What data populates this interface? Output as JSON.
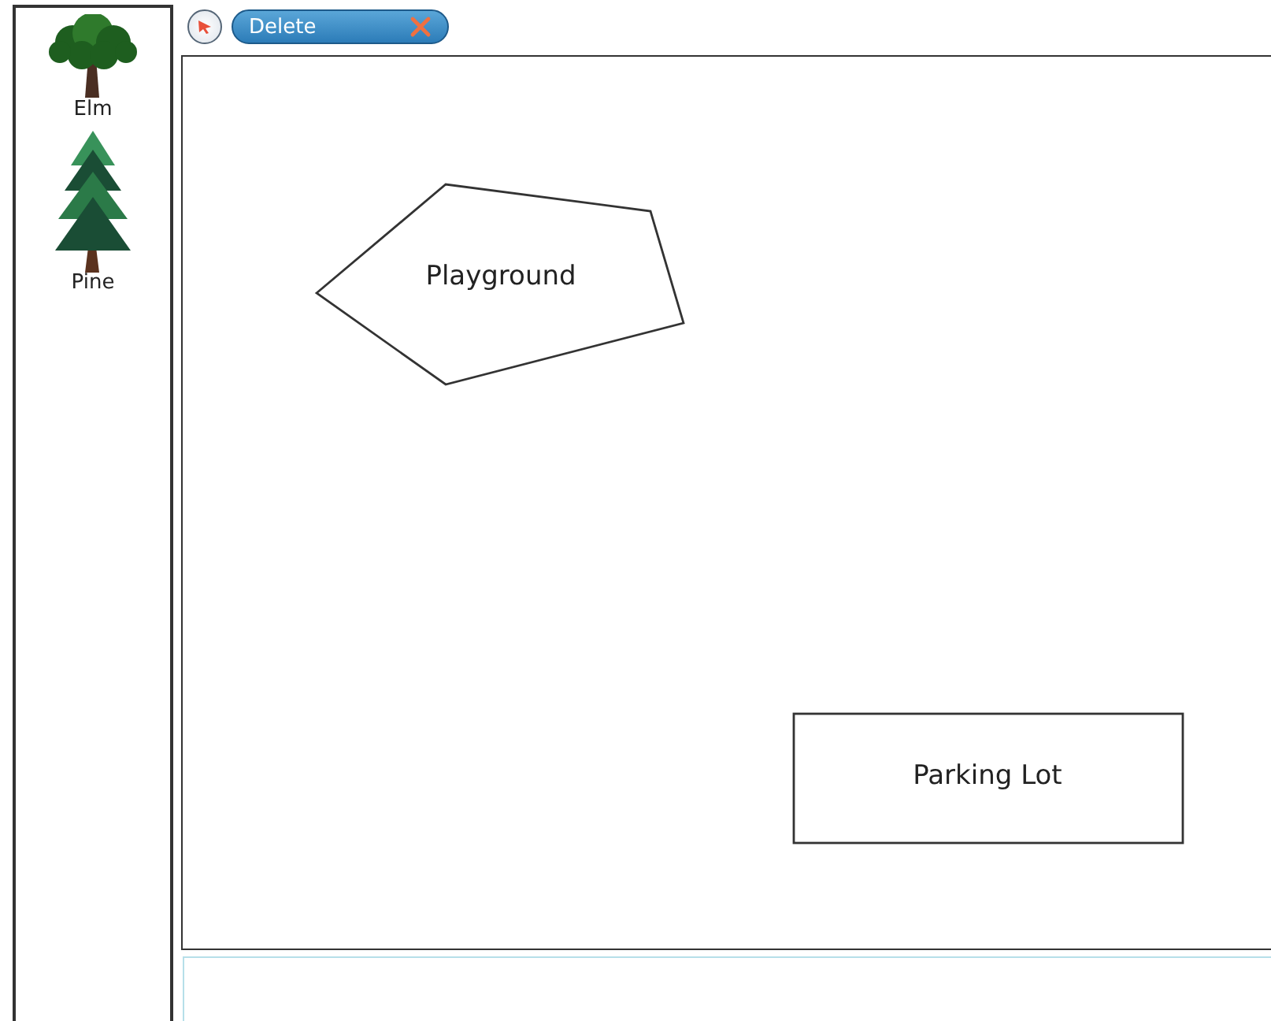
{
  "palette": {
    "items": [
      {
        "kind": "elm",
        "label": "Elm"
      },
      {
        "kind": "pine",
        "label": "Pine"
      }
    ]
  },
  "toolbar": {
    "delete_button": "Delete"
  },
  "canvas": {
    "shapes": [
      {
        "kind": "polygon",
        "label": "Playground"
      },
      {
        "kind": "rect",
        "label": "Parking Lot"
      }
    ]
  }
}
